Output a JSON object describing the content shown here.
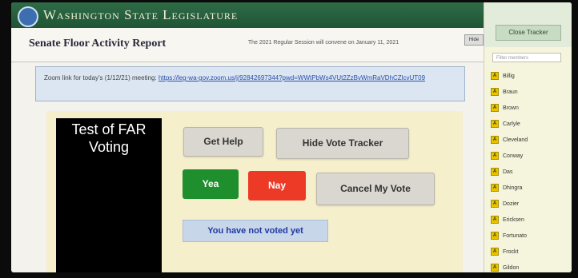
{
  "header": {
    "title": "Washington State Legislature"
  },
  "subbar": {
    "report_title": "Senate Floor Activity Report",
    "session_note": "The 2021 Regular Session will convene on January 11, 2021",
    "mini_button": "Hide"
  },
  "zoom": {
    "prefix": "Zoom link for today's (1/12/21) meeting: ",
    "link": "https://leg-wa-gov.zoom.us/j/92842697344?pwd=WWtPbWs4VUt2ZzBvWmRaVDhCZlcvUT09"
  },
  "vote_panel": {
    "title": "Test of FAR Voting",
    "get_help": "Get Help",
    "hide_tracker": "Hide Vote Tracker",
    "yea": "Yea",
    "nay": "Nay",
    "cancel": "Cancel My Vote",
    "status": "You have not voted yet"
  },
  "sidebar": {
    "button": "Close Tracker",
    "filter_placeholder": "Filter members",
    "members": [
      {
        "badge": "A",
        "name": "Billig"
      },
      {
        "badge": "A",
        "name": "Braun"
      },
      {
        "badge": "A",
        "name": "Brown"
      },
      {
        "badge": "A",
        "name": "Carlyle"
      },
      {
        "badge": "A",
        "name": "Cleveland"
      },
      {
        "badge": "A",
        "name": "Conway"
      },
      {
        "badge": "A",
        "name": "Das"
      },
      {
        "badge": "A",
        "name": "Dhingra"
      },
      {
        "badge": "A",
        "name": "Dozier"
      },
      {
        "badge": "A",
        "name": "Ericksen"
      },
      {
        "badge": "A",
        "name": "Fortunato"
      },
      {
        "badge": "A",
        "name": "Frockt"
      },
      {
        "badge": "A",
        "name": "Gildon"
      }
    ]
  },
  "colors": {
    "header": "#2f6b47",
    "yea": "#1e8f2c",
    "nay": "#ec3a26",
    "panel": "#f6efcc"
  }
}
